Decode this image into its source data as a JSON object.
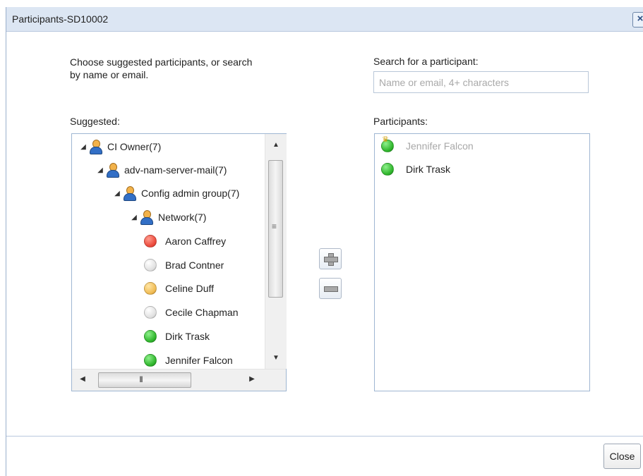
{
  "dialog": {
    "title": "Participants-SD10002",
    "close_icon": "close-icon",
    "instructions": "Choose suggested participants, or search by name or email.",
    "search_label": "Search for a participant:",
    "search_placeholder": "Name or email, 4+ characters",
    "suggested_label": "Suggested:",
    "participants_label": "Participants:"
  },
  "tree": {
    "groups": [
      {
        "label": "CI Owner(7)",
        "icon": "group-owner-icon",
        "expanded": true
      },
      {
        "label": "adv-nam-server-mail(7)",
        "icon": "group-owner-icon",
        "expanded": true
      },
      {
        "label": "Config admin group(7)",
        "icon": "group-owner-icon",
        "expanded": true
      },
      {
        "label": "Network(7)",
        "icon": "group-owner-icon",
        "expanded": true
      }
    ],
    "people": [
      {
        "name": "Aaron Caffrey",
        "status_color": "#ec4b3d"
      },
      {
        "name": "Brad Contner",
        "status_color": "#e1e1e1"
      },
      {
        "name": "Celine Duff",
        "status_color": "#f1bd56"
      },
      {
        "name": "Cecile Chapman",
        "status_color": "#e1e1e1"
      },
      {
        "name": "Dirk Trask",
        "status_color": "#31b72e"
      },
      {
        "name": "Jennifer Falcon",
        "status_color": "#31b72e"
      }
    ]
  },
  "participants": [
    {
      "name": "Jennifer Falcon",
      "role": "owner",
      "status_color": "#31b72e",
      "disabled": true
    },
    {
      "name": "Dirk Trask",
      "role": "participant",
      "status_color": "#31b72e",
      "disabled": false
    }
  ],
  "actions": {
    "add_icon": "plus-icon",
    "remove_icon": "minus-icon",
    "close_label": "Close"
  },
  "scrollbar": {
    "vertical_grip": "≡",
    "horizontal_grip": "III"
  }
}
